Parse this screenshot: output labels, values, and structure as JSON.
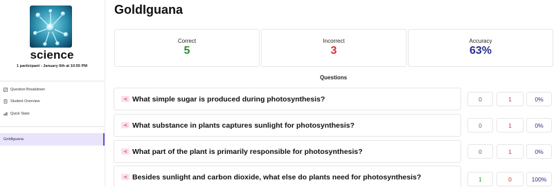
{
  "sidebar": {
    "set_title": "science",
    "subtitle": "1 participant - January 6th at 10:55 PM",
    "nav": [
      {
        "label": "Question Breakdown",
        "icon": "edit-icon"
      },
      {
        "label": "Student Overview",
        "icon": "document-icon"
      },
      {
        "label": "Quick Stats",
        "icon": "bar-chart-icon"
      }
    ],
    "selected_player": "GoldIguana"
  },
  "main": {
    "title": "GoldIguana",
    "stats": [
      {
        "label": "Correct",
        "value": "5",
        "color": "#2f8a2f"
      },
      {
        "label": "Incorrect",
        "value": "3",
        "color": "#d43030"
      },
      {
        "label": "Accuracy",
        "value": "63%",
        "color": "#2a2f8f"
      }
    ],
    "questions_heading": "Questions",
    "questions": [
      {
        "text": "What simple sugar is produced during photosynthesis?",
        "correct": "0",
        "incorrect": "1",
        "accuracy": "0%"
      },
      {
        "text": "What substance in plants captures sunlight for photosynthesis?",
        "correct": "0",
        "incorrect": "1",
        "accuracy": "0%"
      },
      {
        "text": "What part of the plant is primarily responsible for photosynthesis?",
        "correct": "0",
        "incorrect": "1",
        "accuracy": "0%"
      },
      {
        "text": "Besides sunlight and carbon dioxide, what else do plants need for photosynthesis?",
        "correct": "1",
        "incorrect": "0",
        "accuracy": "100%"
      }
    ]
  }
}
